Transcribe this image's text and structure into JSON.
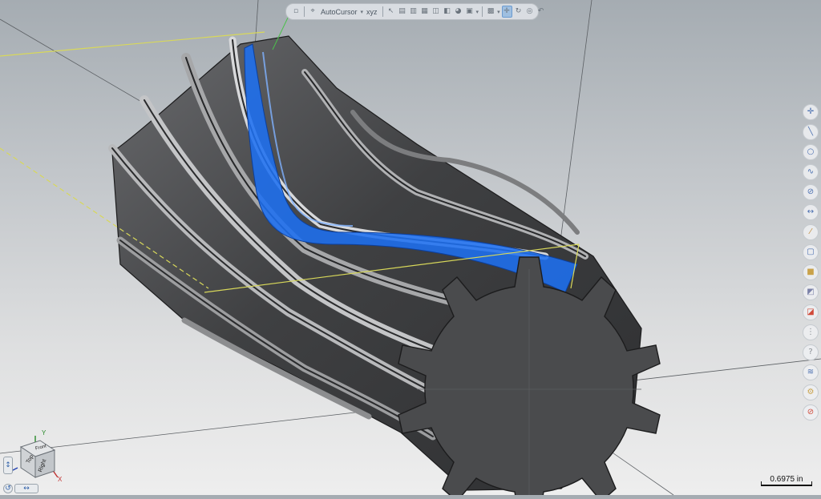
{
  "toolbar": {
    "autocursor_label": "AutoCursor",
    "coordinate_mode_label": "xyz"
  },
  "view_cube": {
    "axis_x": "X",
    "axis_y": "Y",
    "face_top": "Top",
    "face_right": "Right",
    "face_front": "Front"
  },
  "scale": {
    "label": "0.6975 in"
  },
  "model": {
    "tooth_count": 13,
    "highlight_color": "#1e6ff0",
    "sketch_line_color": "#d8d85a",
    "body_color": "#4a4b4d"
  },
  "icons": {
    "right_toolbar": [
      "point-icon",
      "line-icon",
      "circle-icon",
      "spline-icon",
      "ellipse-icon",
      "dimension-icon",
      "slash-icon",
      "box-icon",
      "solid-icon",
      "shade-icon",
      "color-icon",
      "grid-icon",
      "info-icon",
      "layer-icon",
      "settings-icon",
      "no-entry-icon"
    ]
  }
}
